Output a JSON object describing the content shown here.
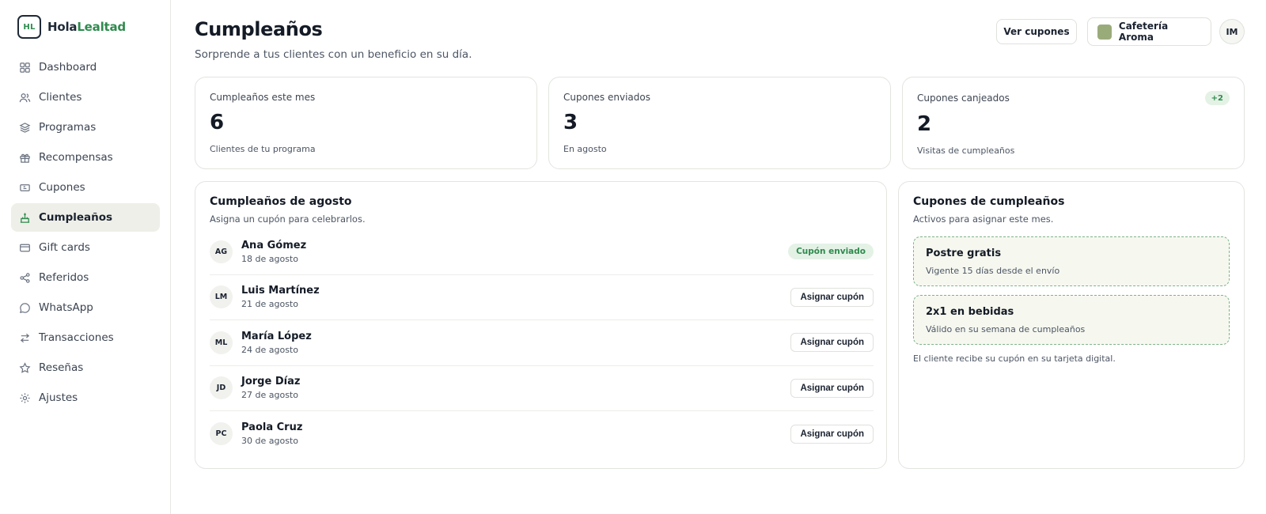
{
  "brand": {
    "logo_text": "HL",
    "name_part1": "Hola",
    "name_part2": "Lealtad"
  },
  "sidebar": {
    "items": [
      {
        "label": "Dashboard",
        "icon": "grid-icon"
      },
      {
        "label": "Clientes",
        "icon": "users-icon"
      },
      {
        "label": "Programas",
        "icon": "layers-icon"
      },
      {
        "label": "Recompensas",
        "icon": "gift-icon"
      },
      {
        "label": "Cupones",
        "icon": "ticket-icon"
      },
      {
        "label": "Cumpleaños",
        "icon": "cake-icon",
        "active": true
      },
      {
        "label": "Gift cards",
        "icon": "card-icon"
      },
      {
        "label": "Referidos",
        "icon": "share-icon"
      },
      {
        "label": "WhatsApp",
        "icon": "chat-icon"
      },
      {
        "label": "Transacciones",
        "icon": "swap-icon"
      },
      {
        "label": "Reseñas",
        "icon": "star-icon"
      },
      {
        "label": "Ajustes",
        "icon": "settings-icon"
      }
    ]
  },
  "header": {
    "title": "Cumpleaños",
    "subtitle": "Sorprende a tus clientes con un beneficio en su día.",
    "coupons_button": "Ver cupones",
    "store_name": "Cafetería Aroma",
    "user_initials": "IM"
  },
  "stats": [
    {
      "label": "Cumpleaños este mes",
      "value": "6",
      "note": "Clientes de tu programa"
    },
    {
      "label": "Cupones enviados",
      "value": "3",
      "note": "En agosto"
    },
    {
      "label": "Cupones canjeados",
      "value": "2",
      "note": "Visitas de cumpleaños",
      "badge": "+2"
    }
  ],
  "birthdays": {
    "title": "Cumpleaños de agosto",
    "subtitle": "Asigna un cupón para celebrarlos.",
    "rows": [
      {
        "initials": "AG",
        "name": "Ana Gómez",
        "date": "18 de agosto",
        "status": "Cupón enviado"
      },
      {
        "initials": "LM",
        "name": "Luis Martínez",
        "date": "21 de agosto",
        "action": "Asignar cupón"
      },
      {
        "initials": "ML",
        "name": "María López",
        "date": "24 de agosto",
        "action": "Asignar cupón"
      },
      {
        "initials": "JD",
        "name": "Jorge Díaz",
        "date": "27 de agosto",
        "action": "Asignar cupón"
      },
      {
        "initials": "PC",
        "name": "Paola Cruz",
        "date": "30 de agosto",
        "action": "Asignar cupón"
      }
    ]
  },
  "coupons": {
    "title": "Cupones de cumpleaños",
    "subtitle": "Activos para asignar este mes.",
    "items": [
      {
        "title": "Postre gratis",
        "desc": "Vigente 15 días desde el envío"
      },
      {
        "title": "2x1 en bebidas",
        "desc": "Válido en su semana de cumpleaños"
      }
    ],
    "footnote": "El cliente recibe su cupón en su tarjeta digital."
  },
  "colors": {
    "accent": "#2f8a4e",
    "active_bg": "#eeefe8",
    "store_swatch": "#9aab7a"
  }
}
